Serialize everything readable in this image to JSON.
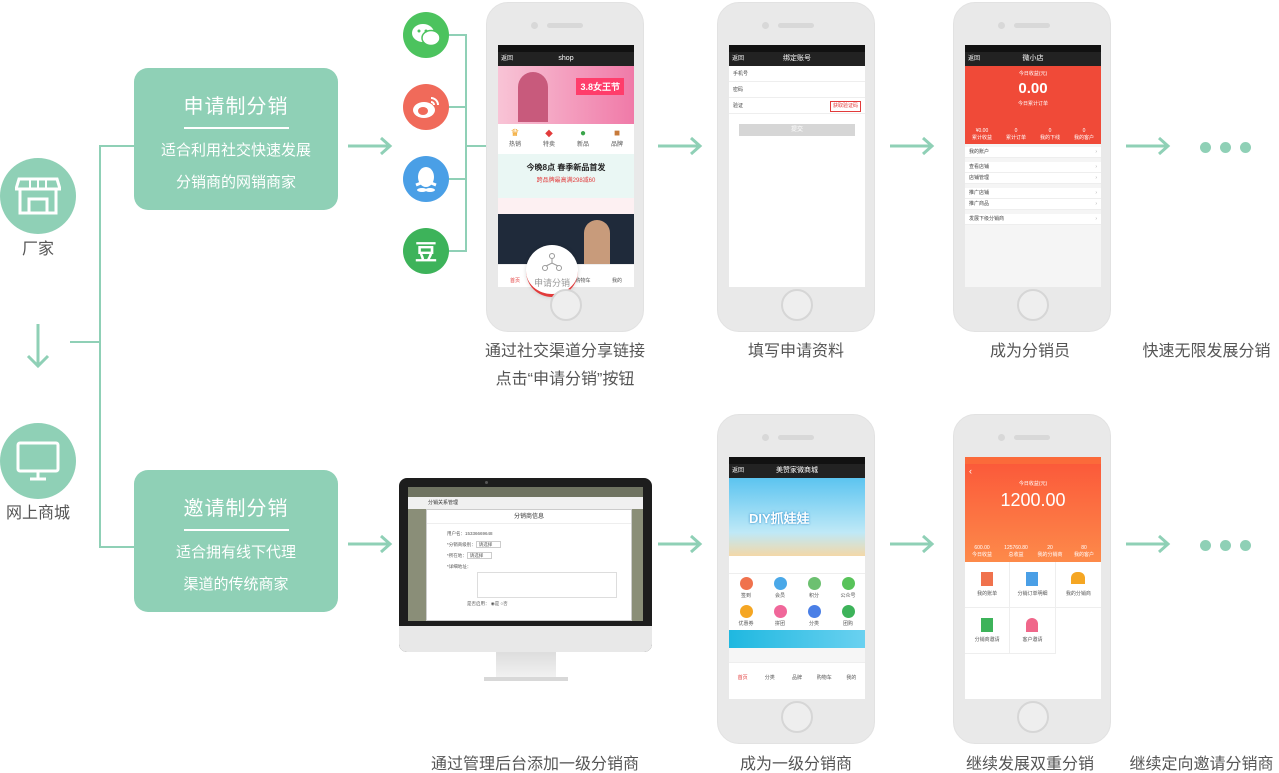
{
  "left": {
    "factory_label": "厂家",
    "mall_label": "网上商城"
  },
  "cards": {
    "apply": {
      "title": "申请制分销",
      "line1": "适合利用社交快速发展",
      "line2": "分销商的网销商家"
    },
    "invite": {
      "title": "邀请制分销",
      "line1": "适合拥有线下代理",
      "line2": "渠道的传统商家"
    }
  },
  "social": {
    "douban_glyph": "豆"
  },
  "top_steps": {
    "step1_line1": "通过社交渠道分享链接",
    "step1_line2": "点击“申请分销”按钮",
    "step2": "填写申请资料",
    "step3": "成为分销员",
    "step4": "快速无限发展分销"
  },
  "bottom_steps": {
    "step1": "通过管理后台添加一级分销商",
    "step2": "成为一级分销商",
    "step3": "继续发展双重分销",
    "step4": "继续定向邀请分销商"
  },
  "phone_shop": {
    "title": "shop",
    "back": "返回",
    "banner": "3.8女王节",
    "cats": [
      "热销",
      "特卖",
      "新品",
      "品牌"
    ],
    "promo": "今晚8点 春季新品首发",
    "promo_sub": "跨品牌最高满298减60",
    "apply_button": "申请分销",
    "tabs": [
      "首页",
      "",
      "购物车",
      "我的"
    ]
  },
  "phone_form": {
    "back": "返回",
    "title": "绑定账号",
    "fields": [
      "手机号",
      "密码",
      "验证"
    ],
    "code_btn": "获取验证码",
    "submit": "提交"
  },
  "phone_store": {
    "back": "返回",
    "title": "微小店",
    "today_label": "今日收益(元)",
    "amount": "0.00",
    "today_orders": "今日累计订单",
    "stats": [
      "¥0.00",
      "0",
      "0",
      "0"
    ],
    "stat_labels": [
      "累计收益",
      "累计订单",
      "我的下线",
      "我的客户"
    ],
    "menu": [
      "我的账户",
      "查看店铺",
      "店铺管理",
      "推广店铺",
      "推广商品",
      "发展下级分销商"
    ]
  },
  "phone_mall": {
    "back": "返回",
    "title": "美赞家微商城",
    "banner": "DIY抓娃娃",
    "icons": [
      "签到",
      "会员",
      "积分",
      "公众号",
      "优惠券",
      "拼团",
      "分类",
      "团购"
    ],
    "tabs": [
      "首页",
      "分类",
      "品牌",
      "购物车",
      "我的"
    ]
  },
  "phone_dist": {
    "today_label": "今日收益(元)",
    "amount": "1200.00",
    "stats": [
      "600.00",
      "125760.80",
      "20",
      "80"
    ],
    "stat_labels": [
      "今日收益",
      "总收益",
      "我的分销商",
      "我的客户"
    ],
    "grid": [
      "我的账单",
      "分销订单明细",
      "我的分销商",
      "分销商邀请",
      "客户邀请"
    ]
  },
  "monitor": {
    "header": "分销关系管理",
    "dialog_title": "分销商信息",
    "phone_label": "用户名：",
    "phone_value": "15336669648",
    "level_label": "*分销商级别：",
    "level_value": "请选择",
    "region_label": "*所在地：",
    "region_value": "请选择",
    "addr_label": "*详细地址：",
    "status_label": "是否启用：",
    "status_yes": "是",
    "status_no": "否"
  },
  "colors": {
    "accent": "#8fd0b6",
    "wechat": "#4cc35e",
    "weibo": "#f06a5a",
    "qq": "#4a9fe6",
    "douban": "#3db35a",
    "store_red": "#f04a38",
    "dist_orange": "#fb6a3a"
  }
}
